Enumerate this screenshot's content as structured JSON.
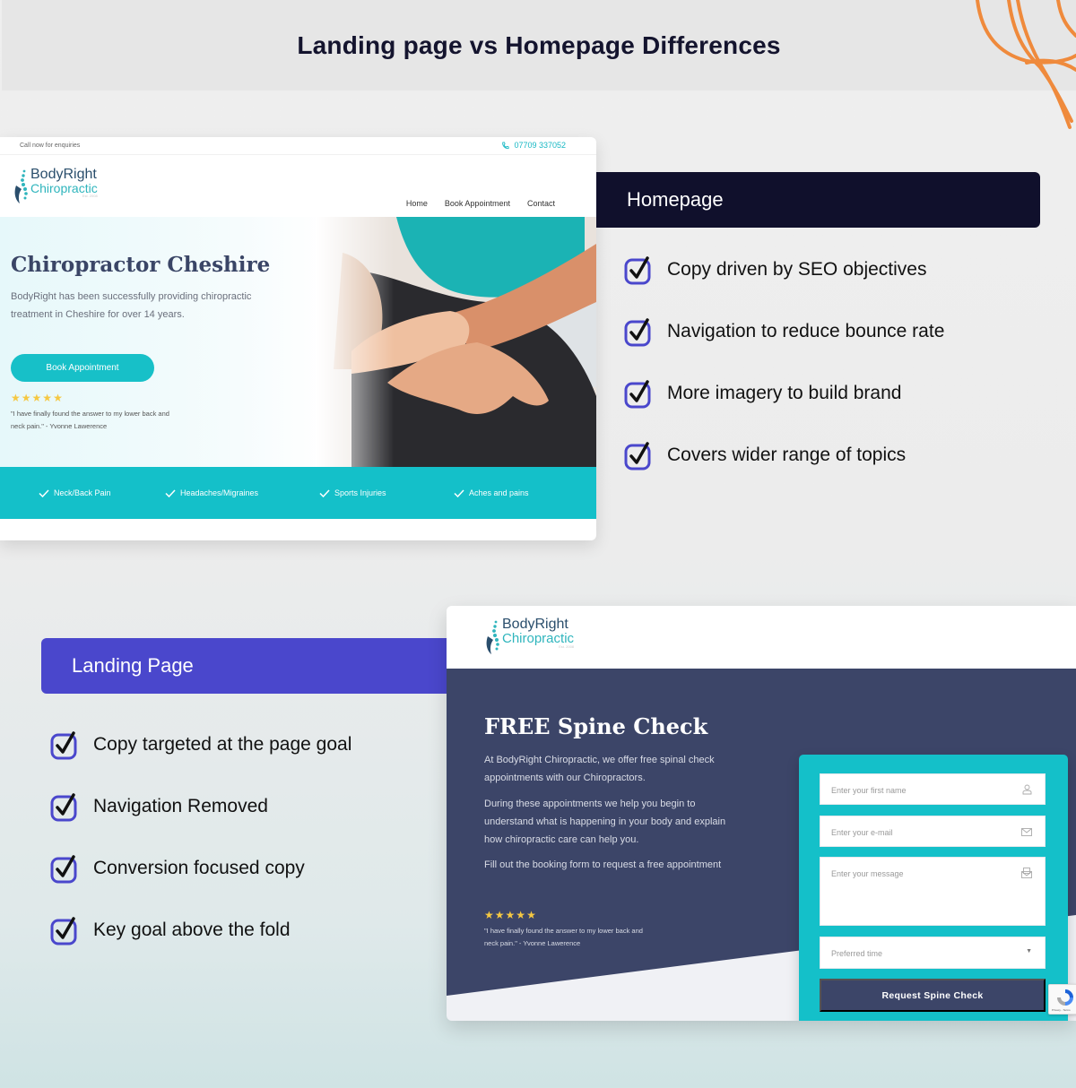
{
  "page": {
    "title": "Landing page vs Homepage Differences"
  },
  "colors": {
    "accent_teal": "#14c0c9",
    "navy": "#3c4568",
    "dark_navy": "#10102c",
    "purple": "#4a47cc",
    "orange_scribble": "#ef8a3c",
    "star_yellow": "#f5c842"
  },
  "brand": {
    "line1": "BodyRight",
    "line2": "Chiropractic",
    "est": "Est. 2008"
  },
  "homepage_mockup": {
    "topbar": {
      "enquiries": "Call now for enquiries",
      "phone_icon": "phone-icon",
      "phone": "07709 337052"
    },
    "nav": [
      "Home",
      "Book Appointment",
      "Contact"
    ],
    "hero": {
      "heading": "Chiropractor Cheshire",
      "paragraph": "BodyRight has been successfully providing chiropractic treatment in Cheshire for over 14 years.",
      "button": "Book Appointment",
      "rating": 5,
      "quote": "\"I have finally found the answer to my lower back and neck pain.\" - Yvonne Lawerence"
    },
    "services": [
      "Neck/Back Pain",
      "Headaches/Migraines",
      "Sports Injuries",
      "Aches and pains"
    ]
  },
  "homepage_panel": {
    "label": "Homepage",
    "items": [
      "Copy driven by SEO objectives",
      "Navigation to reduce bounce rate",
      "More imagery to build brand",
      "Covers wider range of topics"
    ]
  },
  "landing_panel": {
    "label": "Landing Page",
    "items": [
      "Copy targeted at the page goal",
      "Navigation Removed",
      "Conversion focused copy",
      "Key goal above the fold"
    ]
  },
  "landing_mockup": {
    "heading": "FREE Spine Check",
    "paragraphs": [
      "At BodyRight Chiropractic, we offer free spinal check appointments with our Chiropractors.",
      "During these appointments we help you begin to understand what is happening in your body and explain how chiropractic care can help you.",
      "Fill out the booking form to request a free appointment"
    ],
    "rating": 5,
    "quote": "\"I have finally found the answer to my lower back and neck pain.\" - Yvonne Lawerence",
    "form": {
      "name_placeholder": "Enter your first name",
      "email_placeholder": "Enter your e-mail",
      "message_placeholder": "Enter your message",
      "time_placeholder": "Preferred time",
      "submit": "Request Spine Check"
    },
    "recaptcha_text": "Privacy - Terms"
  }
}
